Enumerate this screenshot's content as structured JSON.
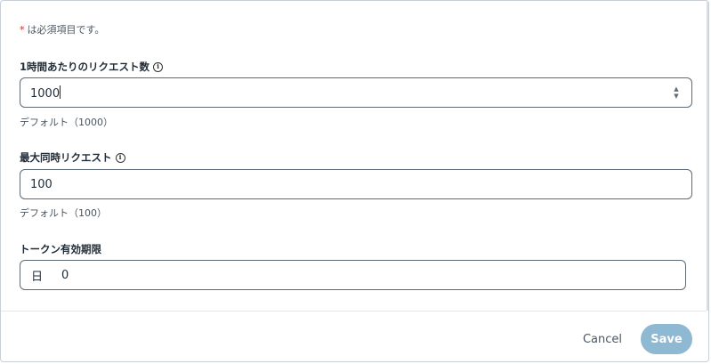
{
  "form": {
    "required_star": "*",
    "required_note": "は必須項目です。"
  },
  "fields": {
    "requests_per_hour": {
      "label": "1時間あたりのリクエスト数",
      "value": "1000",
      "helper": "デフォルト（1000）",
      "info_icon": "info-icon"
    },
    "max_concurrent": {
      "label": "最大同時リクエスト",
      "value": "100",
      "helper": "デフォルト（100）",
      "info_icon": "info-icon"
    },
    "token_expiry": {
      "label": "トークン有効期限",
      "unit": "日",
      "value": "0"
    }
  },
  "footer": {
    "cancel_label": "Cancel",
    "save_label": "Save",
    "save_color": "#8fb8d2"
  }
}
